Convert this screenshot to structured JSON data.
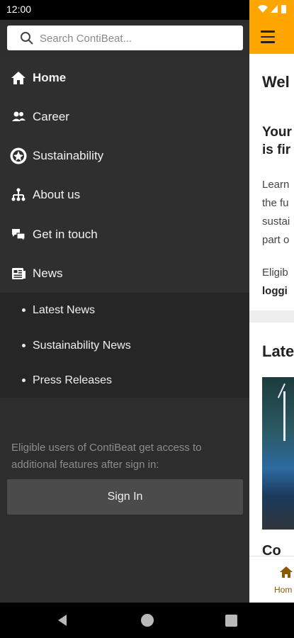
{
  "status": {
    "time": "12:00"
  },
  "search": {
    "placeholder": "Search ContiBeat..."
  },
  "nav": {
    "items": [
      {
        "label": "Home",
        "icon": "home-icon",
        "active": true
      },
      {
        "label": "Career",
        "icon": "people-icon"
      },
      {
        "label": "Sustainability",
        "icon": "globe-icon"
      },
      {
        "label": "About us",
        "icon": "org-chart-icon"
      },
      {
        "label": "Get in touch",
        "icon": "chat-icon"
      },
      {
        "label": "News",
        "icon": "newspaper-icon"
      }
    ],
    "sub_items": [
      {
        "label": "Latest News"
      },
      {
        "label": "Sustainability News"
      },
      {
        "label": "Press Releases"
      }
    ]
  },
  "signin": {
    "note": "Eligible users of ContiBeat get access to additional features after sign in:",
    "button": "Sign In"
  },
  "app": {
    "welcome": "Wel",
    "headline_1": "Your",
    "headline_2": "is fir",
    "lines": [
      "Learn",
      "the fu",
      "sustai",
      "part o"
    ],
    "eligible_1": "Eligib",
    "eligible_2": "loggi",
    "latest": "Late",
    "news_title": "Co",
    "tab_home": "Hom"
  },
  "colors": {
    "accent": "#ffa500",
    "drawer": "#2d2d2d"
  }
}
